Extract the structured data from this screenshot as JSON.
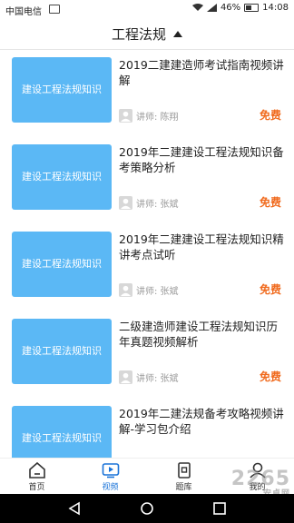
{
  "status_bar": {
    "carrier": "中国电信",
    "battery": "46%",
    "time": "14:08"
  },
  "header": {
    "title": "工程法规"
  },
  "courses": [
    {
      "thumb": "建设工程法规知识",
      "title": "2019二建建造师考试指南视频讲解",
      "teacher": "讲师: 陈翔",
      "price": "免费"
    },
    {
      "thumb": "建设工程法规知识",
      "title": "2019年二建建设工程法规知识备考策略分析",
      "teacher": "讲师: 张斌",
      "price": "免费"
    },
    {
      "thumb": "建设工程法规知识",
      "title": "2019年二建建设工程法规知识精讲考点试听",
      "teacher": "讲师: 张斌",
      "price": "免费"
    },
    {
      "thumb": "建设工程法规知识",
      "title": "二级建造师建设工程法规知识历年真题视频解析",
      "teacher": "讲师: 张斌",
      "price": "免费"
    },
    {
      "thumb": "建设工程法规知识",
      "title": "2019年二建法规备考攻略视频讲解-学习包介绍",
      "teacher": "",
      "price": ""
    }
  ],
  "tabs": [
    {
      "label": "首页",
      "icon": "home-icon"
    },
    {
      "label": "视频",
      "icon": "video-icon"
    },
    {
      "label": "题库",
      "icon": "question-bank-icon"
    },
    {
      "label": "我的",
      "icon": "profile-icon"
    }
  ],
  "watermark": {
    "brand": "2265",
    "site": "安卓网"
  },
  "colors": {
    "accent": "#1a73d8",
    "thumb": "#5bb8f5",
    "price": "#f06a1d"
  }
}
